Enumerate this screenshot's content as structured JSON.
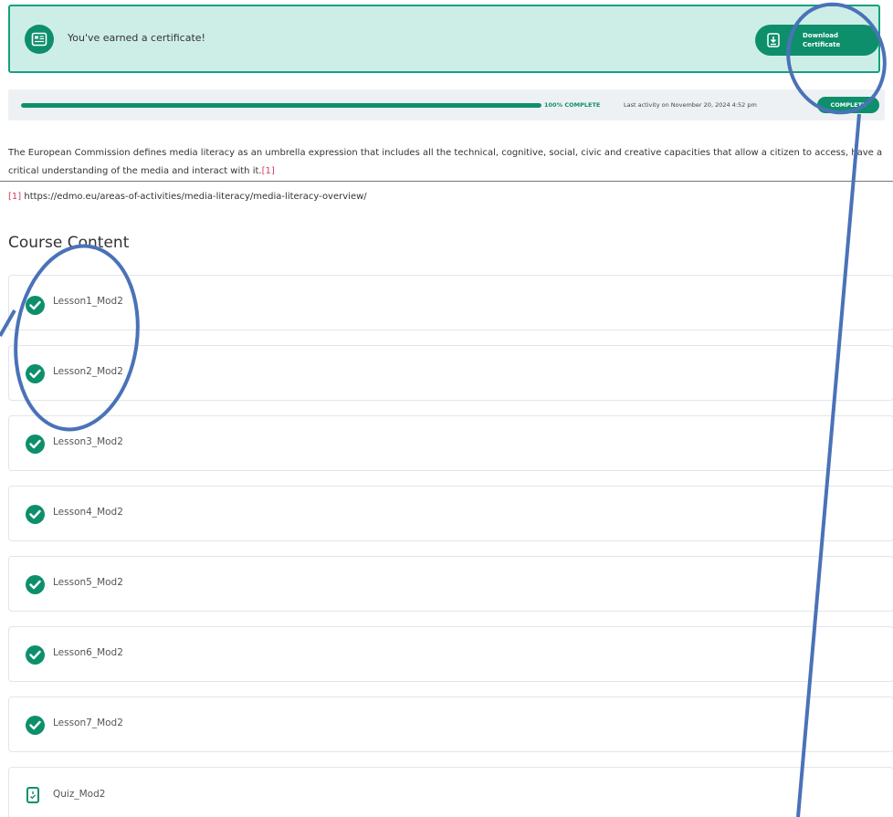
{
  "certificate": {
    "message": "You've earned a certificate!",
    "download_label": "Download\nCertificate"
  },
  "progress": {
    "percent_text": "100% COMPLETE",
    "percent_value": 100,
    "activity": "Last activity on November 20, 2024 4:52 pm",
    "badge": "COMPLETE"
  },
  "description": {
    "text": "The European Commission defines media literacy as an umbrella expression that includes all the technical, cognitive, social, civic and creative capacities that allow a citizen to access, have a critical understanding of the media and interact with it.",
    "ref_marker": "[1]"
  },
  "footnote": {
    "marker": "[1]",
    "url": " https://edmo.eu/areas-of-activities/media-literacy/media-literacy-overview/"
  },
  "course": {
    "title": "Course Content",
    "items": [
      {
        "label": "Lesson1_Mod2",
        "status": "complete"
      },
      {
        "label": "Lesson2_Mod2",
        "status": "complete"
      },
      {
        "label": "Lesson3_Mod2",
        "status": "complete"
      },
      {
        "label": "Lesson4_Mod2",
        "status": "complete"
      },
      {
        "label": "Lesson5_Mod2",
        "status": "complete"
      },
      {
        "label": "Lesson6_Mod2",
        "status": "complete"
      },
      {
        "label": "Lesson7_Mod2",
        "status": "complete"
      },
      {
        "label": "Quiz_Mod2",
        "status": "quiz"
      }
    ]
  },
  "colors": {
    "accent": "#0e8f6c",
    "banner_bg": "#cdeee6",
    "annotation": "#4a72b8",
    "ref": "#d63c5b"
  }
}
